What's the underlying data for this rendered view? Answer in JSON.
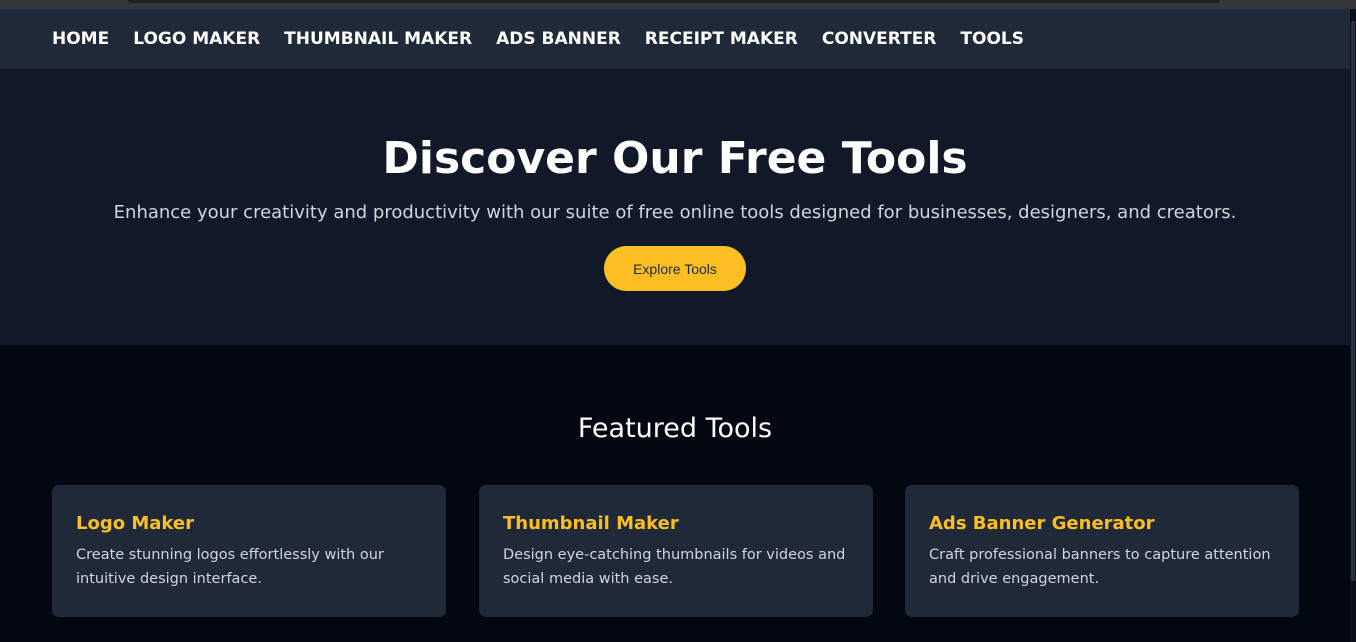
{
  "nav": {
    "items": [
      {
        "label": "HOME"
      },
      {
        "label": "LOGO MAKER"
      },
      {
        "label": "THUMBNAIL MAKER"
      },
      {
        "label": "ADS BANNER"
      },
      {
        "label": "RECEIPT MAKER"
      },
      {
        "label": "CONVERTER"
      },
      {
        "label": "TOOLS"
      }
    ]
  },
  "hero": {
    "title": "Discover Our Free Tools",
    "subtitle": "Enhance your creativity and productivity with our suite of free online tools designed for businesses, designers, and creators.",
    "cta_label": "Explore Tools"
  },
  "featured": {
    "heading": "Featured Tools",
    "cards": [
      {
        "title": "Logo Maker",
        "description": "Create stunning logos effortlessly with our intuitive design interface."
      },
      {
        "title": "Thumbnail Maker",
        "description": "Design eye-catching thumbnails for videos and social media with ease."
      },
      {
        "title": "Ads Banner Generator",
        "description": "Craft professional banners to capture attention and drive engagement."
      }
    ]
  },
  "colors": {
    "nav_bg": "#1f2937",
    "hero_bg": "#111827",
    "page_bg": "#030712",
    "accent": "#fbbf24",
    "card_bg": "#1f2937"
  }
}
